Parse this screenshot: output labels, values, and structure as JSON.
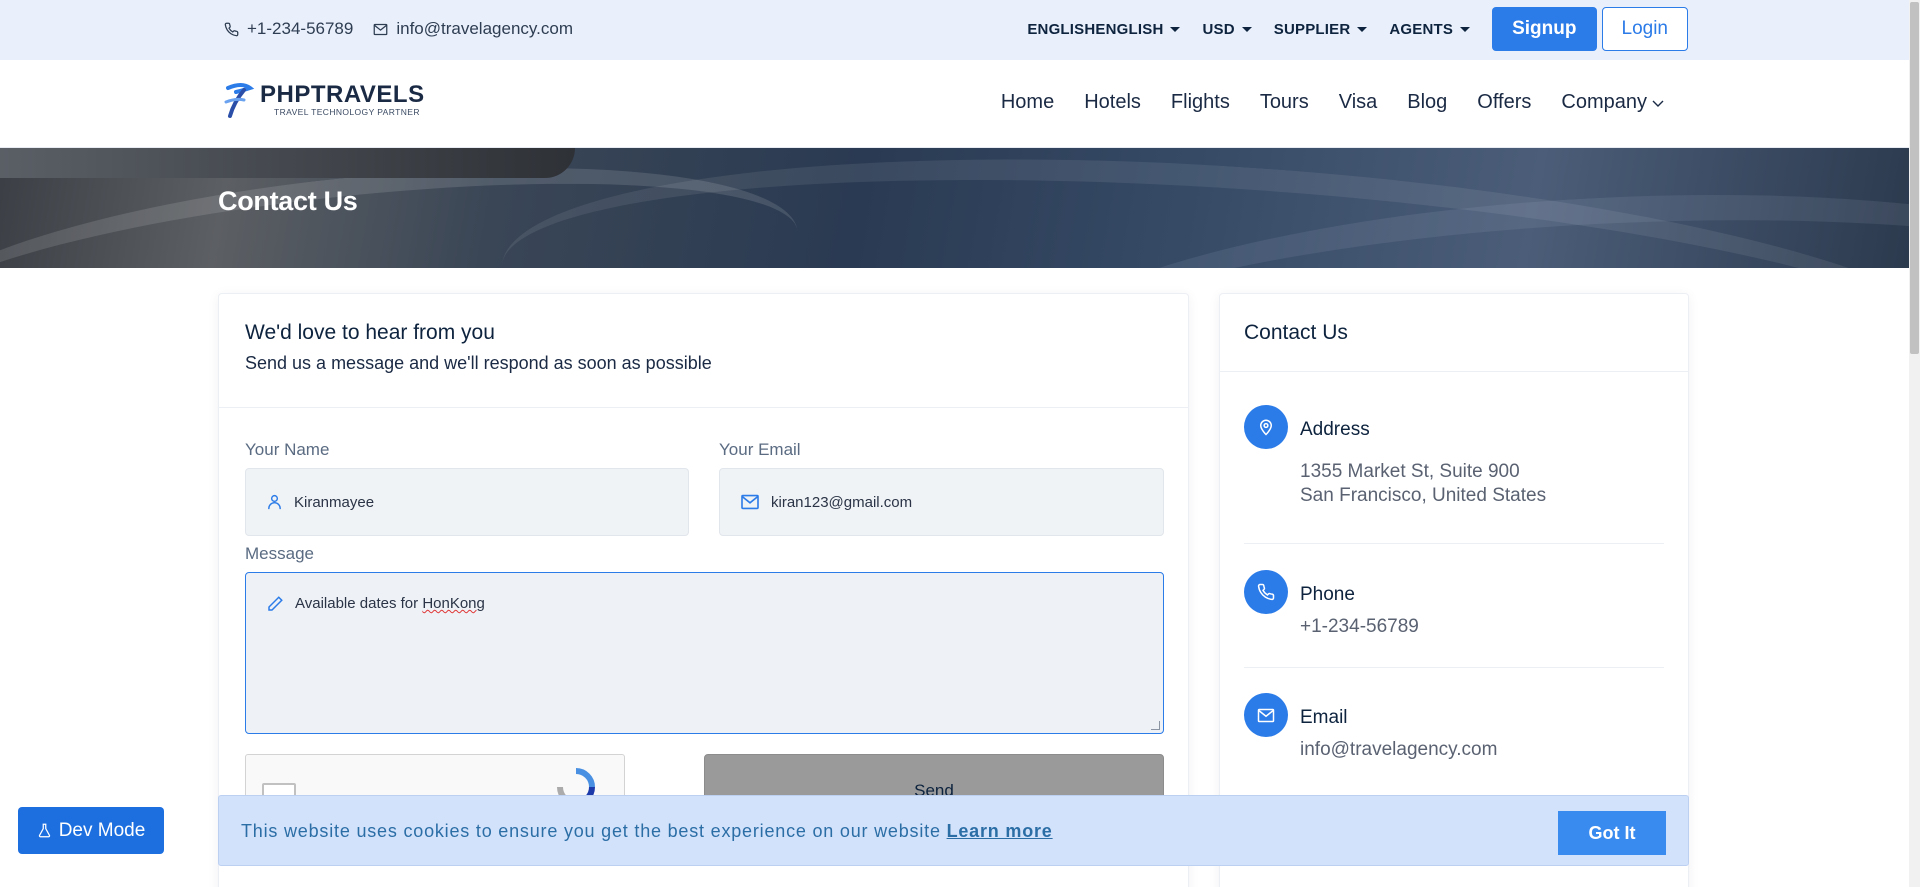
{
  "topbar": {
    "phone": "+1-234-56789",
    "email": "info@travelagency.com",
    "language": "ENGLISHENGLISH",
    "currency": "USD",
    "supplier": "SUPPLIER",
    "agents": "AGENTS",
    "signup": "Signup",
    "login": "Login"
  },
  "navbar": {
    "brand": "PHPTRAVELS",
    "tagline": "TRAVEL TECHNOLOGY PARTNER",
    "links": [
      "Home",
      "Hotels",
      "Flights",
      "Tours",
      "Visa",
      "Blog",
      "Offers",
      "Company"
    ]
  },
  "banner": {
    "title": "Contact Us"
  },
  "form": {
    "heading": "We'd love to hear from you",
    "subheading": "Send us a message and we'll respond as soon as possible",
    "name_label": "Your Name",
    "name_value": "Kiranmayee",
    "email_label": "Your Email",
    "email_value": "kiran123@gmail.com",
    "message_label": "Message",
    "message_prefix": "Available dates for ",
    "message_misspelled": "HonKong",
    "send_label": "Send"
  },
  "info": {
    "title": "Contact Us",
    "address_title": "Address",
    "address_line1": "1355 Market St, Suite 900",
    "address_line2": "San Francisco, United States",
    "phone_title": "Phone",
    "phone_value": "+1-234-56789",
    "email_title": "Email",
    "email_value": "info@travelagency.com"
  },
  "cookie": {
    "message": "This website uses cookies to ensure you get the best experience on our website ",
    "learn_more": "Learn more",
    "button": "Got It"
  },
  "devmode": {
    "label": "Dev Mode"
  },
  "colors": {
    "primary": "#2b7be8",
    "topbar_bg": "#eaf0fb",
    "cookie_bg": "#d3e2fb",
    "send_bg": "#9a9a9a"
  }
}
